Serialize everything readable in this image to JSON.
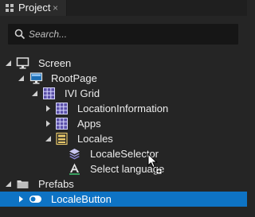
{
  "panel": {
    "tab_label": "Project",
    "tab_close": "×"
  },
  "search": {
    "placeholder": "Search..."
  },
  "tree": {
    "screen": "Screen",
    "root_page": "RootPage",
    "ivi_grid": "IVI Grid",
    "location_information": "LocationInformation",
    "apps": "Apps",
    "locales": "Locales",
    "locale_selector": "LocaleSelector",
    "select_language": "Select language",
    "prefabs": "Prefabs",
    "locale_button": "LocaleButton"
  },
  "colors": {
    "background": "#252525",
    "selection": "#0e73c4",
    "search_bg": "#161616"
  }
}
